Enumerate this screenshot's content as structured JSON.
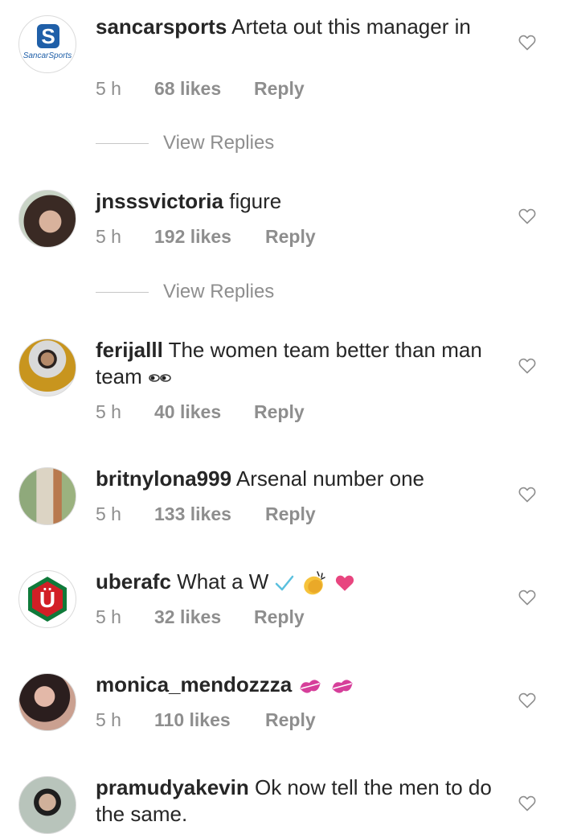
{
  "comments": [
    {
      "username": "sancarsports",
      "text": "Arteta out this manager in",
      "time": "5 h",
      "likes": "68 likes",
      "reply": "Reply",
      "avatar_text": "SancarSports",
      "avatar_letter": "S",
      "view_replies": "View Replies"
    },
    {
      "username": "jnsssvictoria",
      "text": "figure",
      "time": "5 h",
      "likes": "192 likes",
      "reply": "Reply",
      "view_replies": "View Replies"
    },
    {
      "username": "ferijalll",
      "text": "The women team better than man team",
      "time": "5 h",
      "likes": "40 likes",
      "reply": "Reply",
      "emoji": "eyes"
    },
    {
      "username": "britnylona999",
      "text": "Arsenal number one",
      "time": "5 h",
      "likes": "133 likes",
      "reply": "Reply"
    },
    {
      "username": "uberafc",
      "text": "What a W",
      "time": "5 h",
      "likes": "32 likes",
      "reply": "Reply",
      "avatar_letter": "Ü",
      "emoji": "check, clapping hands, heart"
    },
    {
      "username": "monica_mendozzza",
      "text": "",
      "time": "5 h",
      "likes": "110 likes",
      "reply": "Reply",
      "emoji": "kiss marks"
    },
    {
      "username": "pramudyakevin",
      "text": "Ok now tell the men to do the same."
    }
  ],
  "icons": {
    "like": "heart-outline-icon"
  },
  "colors": {
    "text": "#262626",
    "meta": "#8e8e8e",
    "sancar_blue": "#1f5fa8",
    "uber_green": "#0f7a3a",
    "uber_red": "#d21f26",
    "heart_pink": "#e8457f",
    "check_blue": "#5bc0de"
  }
}
